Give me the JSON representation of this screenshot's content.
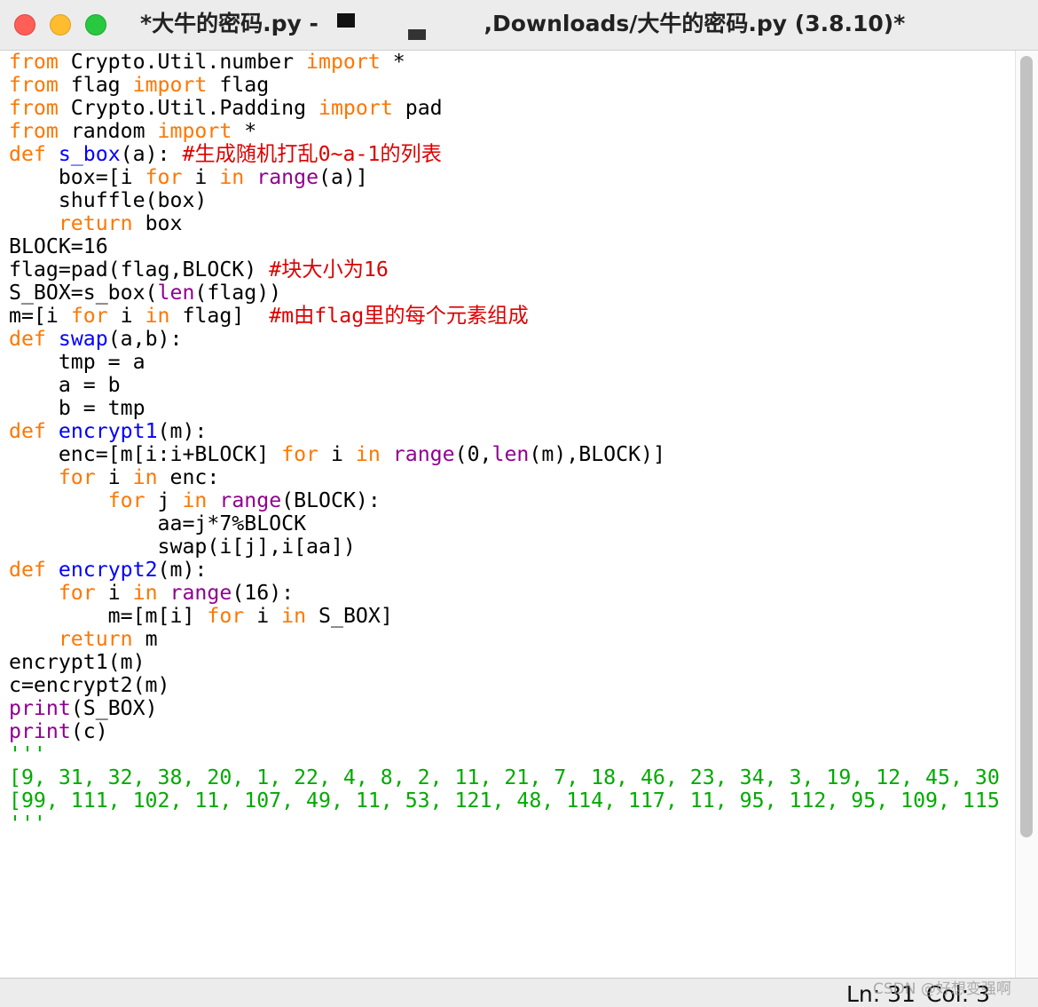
{
  "window": {
    "title_prefix": "*大牛的密码.py - ",
    "title_suffix": ",Downloads/大牛的密码.py (3.8.10)*"
  },
  "editor": {
    "lines": [
      [
        {
          "t": "from",
          "c": "kw"
        },
        {
          "t": " Crypto.Util.number "
        },
        {
          "t": "import",
          "c": "kw"
        },
        {
          "t": " *"
        }
      ],
      [
        {
          "t": "from",
          "c": "kw"
        },
        {
          "t": " flag "
        },
        {
          "t": "import",
          "c": "kw"
        },
        {
          "t": " flag"
        }
      ],
      [
        {
          "t": "from",
          "c": "kw"
        },
        {
          "t": " Crypto.Util.Padding "
        },
        {
          "t": "import",
          "c": "kw"
        },
        {
          "t": " pad"
        }
      ],
      [
        {
          "t": "from",
          "c": "kw"
        },
        {
          "t": " random "
        },
        {
          "t": "import",
          "c": "kw"
        },
        {
          "t": " *"
        }
      ],
      [
        {
          "t": "def",
          "c": "kw"
        },
        {
          "t": " "
        },
        {
          "t": "s_box",
          "c": "fn"
        },
        {
          "t": "(a): "
        },
        {
          "t": "#生成随机打乱0~a-1的列表",
          "c": "cm"
        }
      ],
      [
        {
          "t": "    box=[i "
        },
        {
          "t": "for",
          "c": "kw"
        },
        {
          "t": " i "
        },
        {
          "t": "in",
          "c": "kw"
        },
        {
          "t": " "
        },
        {
          "t": "range",
          "c": "bi"
        },
        {
          "t": "(a)]"
        }
      ],
      [
        {
          "t": "    shuffle(box)"
        }
      ],
      [
        {
          "t": "    "
        },
        {
          "t": "return",
          "c": "kw"
        },
        {
          "t": " box"
        }
      ],
      [
        {
          "t": "BLOCK=16"
        }
      ],
      [
        {
          "t": "flag=pad(flag,BLOCK) "
        },
        {
          "t": "#块大小为16",
          "c": "cm"
        }
      ],
      [
        {
          "t": "S_BOX=s_box("
        },
        {
          "t": "len",
          "c": "bi"
        },
        {
          "t": "(flag))"
        }
      ],
      [
        {
          "t": "m=[i "
        },
        {
          "t": "for",
          "c": "kw"
        },
        {
          "t": " i "
        },
        {
          "t": "in",
          "c": "kw"
        },
        {
          "t": " flag]  "
        },
        {
          "t": "#m由flag里的每个元素组成",
          "c": "cm"
        }
      ],
      [
        {
          "t": "def",
          "c": "kw"
        },
        {
          "t": " "
        },
        {
          "t": "swap",
          "c": "fn"
        },
        {
          "t": "(a,b):"
        }
      ],
      [
        {
          "t": "    tmp = a"
        }
      ],
      [
        {
          "t": "    a = b"
        }
      ],
      [
        {
          "t": "    b = tmp"
        }
      ],
      [
        {
          "t": "def",
          "c": "kw"
        },
        {
          "t": " "
        },
        {
          "t": "encrypt1",
          "c": "fn"
        },
        {
          "t": "(m):"
        }
      ],
      [
        {
          "t": "    enc=[m[i:i+BLOCK] "
        },
        {
          "t": "for",
          "c": "kw"
        },
        {
          "t": " i "
        },
        {
          "t": "in",
          "c": "kw"
        },
        {
          "t": " "
        },
        {
          "t": "range",
          "c": "bi"
        },
        {
          "t": "(0,"
        },
        {
          "t": "len",
          "c": "bi"
        },
        {
          "t": "(m),BLOCK)]"
        }
      ],
      [
        {
          "t": "    "
        },
        {
          "t": "for",
          "c": "kw"
        },
        {
          "t": " i "
        },
        {
          "t": "in",
          "c": "kw"
        },
        {
          "t": " enc:"
        }
      ],
      [
        {
          "t": "        "
        },
        {
          "t": "for",
          "c": "kw"
        },
        {
          "t": " j "
        },
        {
          "t": "in",
          "c": "kw"
        },
        {
          "t": " "
        },
        {
          "t": "range",
          "c": "bi"
        },
        {
          "t": "(BLOCK):"
        }
      ],
      [
        {
          "t": "            aa=j*7%BLOCK"
        }
      ],
      [
        {
          "t": "            swap(i[j],i[aa])"
        }
      ],
      [
        {
          "t": "def",
          "c": "kw"
        },
        {
          "t": " "
        },
        {
          "t": "encrypt2",
          "c": "fn"
        },
        {
          "t": "(m):"
        }
      ],
      [
        {
          "t": "    "
        },
        {
          "t": "for",
          "c": "kw"
        },
        {
          "t": " i "
        },
        {
          "t": "in",
          "c": "kw"
        },
        {
          "t": " "
        },
        {
          "t": "range",
          "c": "bi"
        },
        {
          "t": "(16):"
        }
      ],
      [
        {
          "t": "        m=[m[i] "
        },
        {
          "t": "for",
          "c": "kw"
        },
        {
          "t": " i "
        },
        {
          "t": "in",
          "c": "kw"
        },
        {
          "t": " S_BOX]"
        }
      ],
      [
        {
          "t": "    "
        },
        {
          "t": "return",
          "c": "kw"
        },
        {
          "t": " m"
        }
      ],
      [
        {
          "t": "encrypt1(m)"
        }
      ],
      [
        {
          "t": "c=encrypt2(m)"
        }
      ],
      [
        {
          "t": "print",
          "c": "bi"
        },
        {
          "t": "(S_BOX)"
        }
      ],
      [
        {
          "t": "print",
          "c": "bi"
        },
        {
          "t": "(c)"
        }
      ],
      [
        {
          "t": "'''",
          "c": "st"
        }
      ],
      [
        {
          "t": "[9, 31, 32, 38, 20, 1, 22, 4, 8, 2, 11, 21, 7, 18, 46, 23, 34, 3, 19, 12, 45, 30",
          "c": "st"
        }
      ],
      [
        {
          "t": "[99, 111, 102, 11, 107, 49, 11, 53, 121, 48, 114, 117, 11, 95, 112, 95, 109, 115",
          "c": "st"
        }
      ],
      [
        {
          "t": "'''",
          "c": "st"
        }
      ]
    ]
  },
  "statusbar": {
    "line": "Ln: 31",
    "col": "Col: 3"
  },
  "watermark": "CSDN @好想变强啊"
}
